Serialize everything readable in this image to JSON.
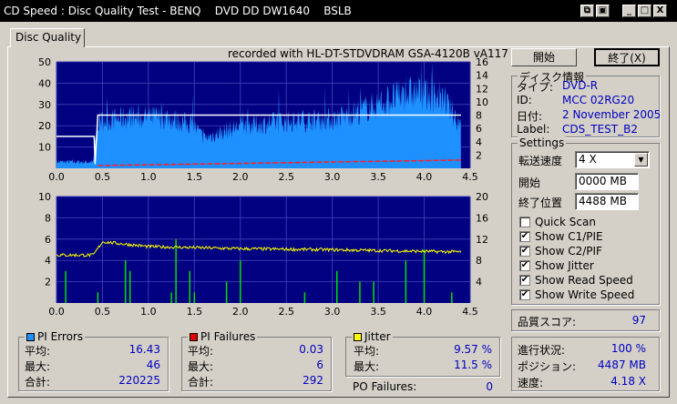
{
  "window": {
    "title": "CD Speed : Disc Quality Test - BENQ    DVD DD DW1640    BSLB",
    "buttons": [
      "copy-icon",
      "save-icon",
      "minimize-icon",
      "maximize-icon",
      "close-icon"
    ]
  },
  "tab": "Disc Quality",
  "recorded_with": "recorded with HL-DT-STDVDRAM GSA-4120B vA117",
  "actions": {
    "start": "開始",
    "exit": "終了(X)"
  },
  "disc_info": {
    "title": "ディスク情報",
    "type_label": "タイプ:",
    "type": "DVD-R",
    "id_label": "ID:",
    "id": "MCC 02RG20",
    "date_label": "日付:",
    "date": "2 November 2005",
    "label_label": "Label:",
    "label": "CDS_TEST_B2"
  },
  "settings": {
    "title": "Settings",
    "speed_label": "転送速度",
    "speed": "4 X",
    "start_label": "開始",
    "start": "0000 MB",
    "end_label": "終了位置",
    "end": "4488 MB",
    "checks": [
      {
        "label": "Quick Scan",
        "checked": false
      },
      {
        "label": "Show C1/PIE",
        "checked": true
      },
      {
        "label": "Show C2/PIF",
        "checked": true
      },
      {
        "label": "Show Jitter",
        "checked": true
      },
      {
        "label": "Show Read Speed",
        "checked": true
      },
      {
        "label": "Show Write Speed",
        "checked": true
      }
    ]
  },
  "quality": {
    "label": "品質スコア:",
    "value": "97"
  },
  "progress": {
    "progress_label": "進行状況:",
    "progress": "100 %",
    "position_label": "ポジション:",
    "position": "4487 MB",
    "speed_label": "速度:",
    "speed": "4.18 X"
  },
  "pi_errors": {
    "title": "PI Errors",
    "color": "#1e90ff",
    "avg_label": "平均:",
    "avg": "16.43",
    "max_label": "最大:",
    "max": "46",
    "total_label": "合計:",
    "total": "220225"
  },
  "pi_failures": {
    "title": "PI Failures",
    "color": "#e00000",
    "avg_label": "平均:",
    "avg": "0.03",
    "max_label": "最大:",
    "max": "6",
    "total_label": "合計:",
    "total": "292"
  },
  "jitter": {
    "title": "Jitter",
    "color": "#ffff00",
    "avg_label": "平均:",
    "avg": "9.57 %",
    "max_label": "最大:",
    "max": "11.5 %"
  },
  "po_failures": {
    "label": "PO Failures:",
    "value": "0"
  },
  "chart_data": [
    {
      "type": "area",
      "xlim": [
        0,
        4.5
      ],
      "ylim": [
        0,
        50
      ],
      "y2lim": [
        0,
        16
      ],
      "xticks": [
        "0.0",
        "0.5",
        "1.0",
        "1.5",
        "2.0",
        "2.5",
        "3.0",
        "3.5",
        "4.0",
        "4.5"
      ],
      "yticks": [
        "10",
        "20",
        "30",
        "40",
        "50"
      ],
      "y2ticks": [
        "2",
        "4",
        "6",
        "8",
        "10",
        "12",
        "14",
        "16"
      ],
      "series": [
        {
          "kind": "PI errors",
          "x": [
            0,
            0.4,
            0.45,
            0.8,
            1.2,
            1.5,
            1.6,
            2.0,
            2.5,
            3.0,
            3.3,
            3.6,
            3.9,
            4.2,
            4.4
          ],
          "y": [
            3,
            3,
            22,
            24,
            24,
            20,
            14,
            20,
            22,
            23,
            27,
            32,
            36,
            33,
            20
          ]
        },
        {
          "kind": "read speed",
          "x": [
            0,
            0.41,
            0.42,
            0.45,
            4.4
          ],
          "y": [
            15,
            15,
            2,
            25,
            25
          ]
        },
        {
          "kind": "write speed",
          "x": [
            0.45,
            4.4
          ],
          "y": [
            1.3,
            3.9
          ]
        }
      ]
    },
    {
      "type": "bar",
      "xlim": [
        0,
        4.5
      ],
      "ylim": [
        0,
        10
      ],
      "y2lim": [
        0,
        20
      ],
      "xticks": [
        "0.0",
        "0.5",
        "1.0",
        "1.5",
        "2.0",
        "2.5",
        "3.0",
        "3.5",
        "4.0",
        "4.5"
      ],
      "yticks": [
        "2",
        "4",
        "6",
        "8",
        "10"
      ],
      "y2ticks": [
        "4",
        "8",
        "12",
        "16",
        "20"
      ],
      "series": [
        {
          "kind": "jitter",
          "x": [
            0,
            0.4,
            0.5,
            1.0,
            2.0,
            3.0,
            4.0,
            4.4
          ],
          "y": [
            9,
            9,
            11.5,
            10.6,
            10.2,
            10,
            9.7,
            9.6
          ]
        },
        {
          "kind": "PI failures",
          "x": [
            0.1,
            0.45,
            0.75,
            0.8,
            1.25,
            1.3,
            1.45,
            1.5,
            1.85,
            2.0,
            2.7,
            3.05,
            3.3,
            3.45,
            3.8,
            4.0,
            4.3
          ],
          "y": [
            3,
            1,
            4,
            3,
            1,
            6,
            3,
            1,
            2,
            4,
            1,
            3,
            2,
            2,
            4,
            5,
            1
          ]
        }
      ]
    }
  ]
}
